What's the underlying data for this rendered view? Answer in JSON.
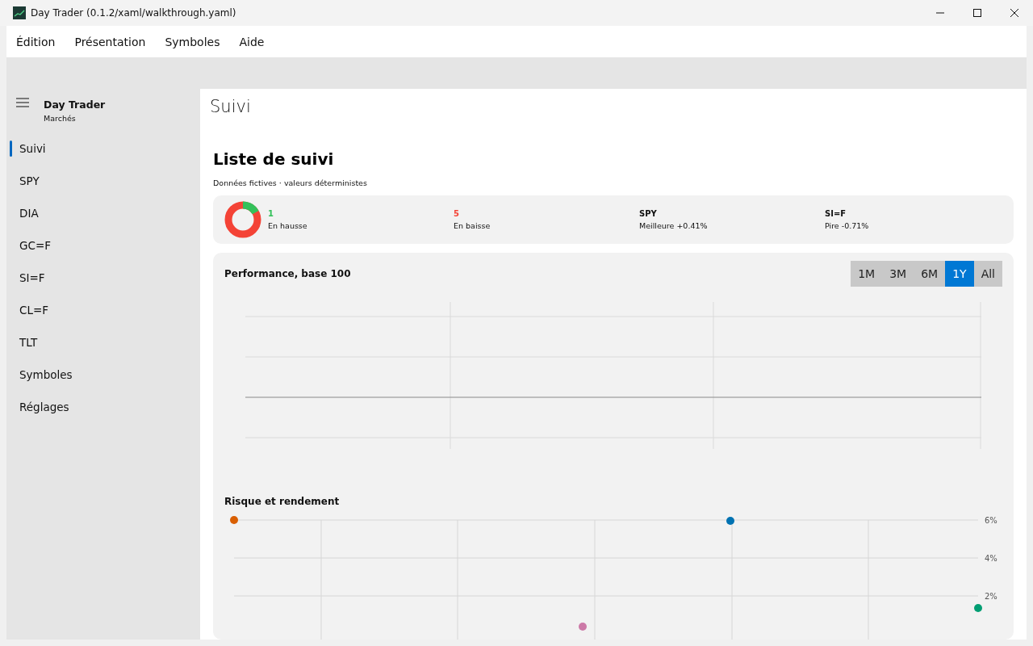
{
  "window": {
    "title": "Day Trader (0.1.2/xaml/walkthrough.yaml)"
  },
  "menu": [
    "Édition",
    "Présentation",
    "Symboles",
    "Aide"
  ],
  "sidebar": {
    "title": "Day Trader",
    "subtitle": "Marchés",
    "items": [
      {
        "label": "Suivi",
        "selected": true
      },
      {
        "label": "SPY",
        "selected": false
      },
      {
        "label": "DIA",
        "selected": false
      },
      {
        "label": "GC=F",
        "selected": false
      },
      {
        "label": "SI=F",
        "selected": false
      },
      {
        "label": "CL=F",
        "selected": false
      },
      {
        "label": "TLT",
        "selected": false
      },
      {
        "label": "Symboles",
        "selected": false
      },
      {
        "label": "Réglages",
        "selected": false
      }
    ]
  },
  "page_title": "Suivi",
  "heading": "Liste de suivi",
  "subheading": "Données fictives · valeurs déterministes",
  "summary": [
    {
      "kind": "up",
      "value": "1",
      "label": "En hausse"
    },
    {
      "kind": "down",
      "value": "5",
      "label": "En baisse"
    },
    {
      "kind": "plain",
      "value": "SPY",
      "label": "Meilleure +0.41%"
    },
    {
      "kind": "plain",
      "value": "SI=F",
      "label": "Pire -0.71%"
    }
  ],
  "performance": {
    "title": "Performance, base 100",
    "ranges": [
      {
        "label": "1M",
        "selected": false
      },
      {
        "label": "3M",
        "selected": false
      },
      {
        "label": "6M",
        "selected": false
      },
      {
        "label": "1Y",
        "selected": true
      },
      {
        "label": "All",
        "selected": false
      }
    ]
  },
  "risk": {
    "title": "Risque et rendement",
    "axis_labels": [
      "6%",
      "4%",
      "2%"
    ],
    "points": [
      {
        "color": "#d95f02"
      },
      {
        "color": "#cc79a7"
      },
      {
        "color": "#0072b2"
      },
      {
        "color": "#009e73"
      }
    ]
  }
}
